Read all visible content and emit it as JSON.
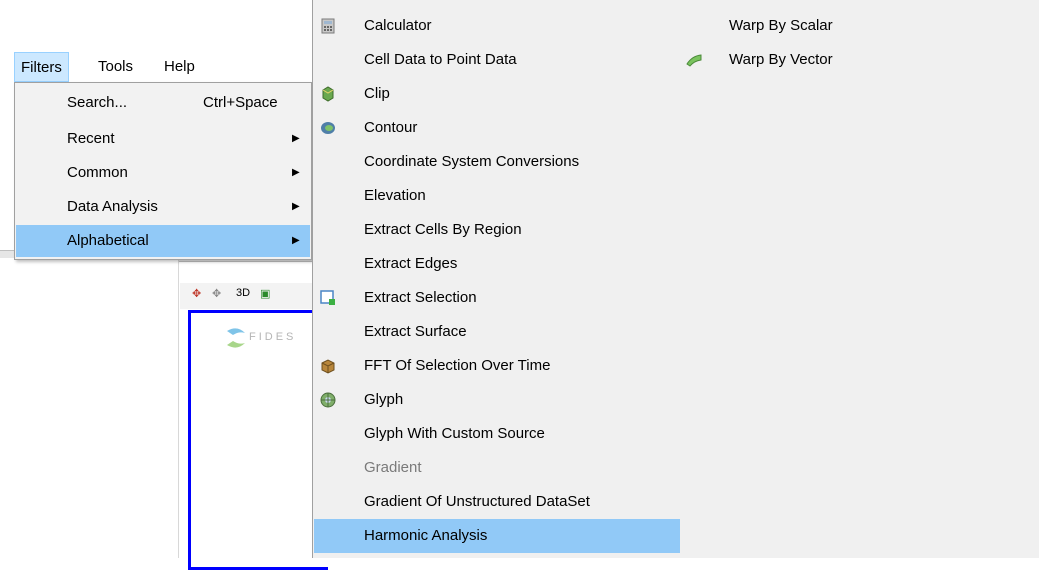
{
  "menubar": {
    "filters": "Filters",
    "tools": "Tools",
    "help": "Help"
  },
  "filters_menu": {
    "items": [
      {
        "label": "Search...",
        "shortcut": "Ctrl+Space"
      },
      {
        "label": "Recent"
      },
      {
        "label": "Common"
      },
      {
        "label": "Data Analysis"
      },
      {
        "label": "Alphabetical"
      }
    ],
    "highlighted": "Alphabetical"
  },
  "toolbar": {
    "view_3d": "3D"
  },
  "viewport": {
    "logo_text": "FIDES"
  },
  "alphabetical_menu": {
    "column1": [
      {
        "label": "Calculator",
        "icon": "calculator-icon"
      },
      {
        "label": "Cell Data to Point Data"
      },
      {
        "label": "Clip",
        "icon": "clip-icon"
      },
      {
        "label": "Contour",
        "icon": "contour-icon"
      },
      {
        "label": "Coordinate System Conversions"
      },
      {
        "label": "Elevation"
      },
      {
        "label": "Extract Cells By Region"
      },
      {
        "label": "Extract Edges"
      },
      {
        "label": "Extract Selection",
        "icon": "extract-selection-icon"
      },
      {
        "label": "Extract Surface"
      },
      {
        "label": "FFT Of Selection Over Time",
        "icon": "fft-icon"
      },
      {
        "label": "Glyph",
        "icon": "glyph-icon"
      },
      {
        "label": "Glyph With Custom Source"
      },
      {
        "label": "Gradient",
        "disabled": true
      },
      {
        "label": "Gradient Of Unstructured DataSet"
      },
      {
        "label": "Harmonic Analysis",
        "highlighted": true
      }
    ],
    "column2": [
      {
        "label": "Warp By Scalar"
      },
      {
        "label": "Warp By Vector",
        "icon": "warp-vector-icon"
      }
    ]
  }
}
